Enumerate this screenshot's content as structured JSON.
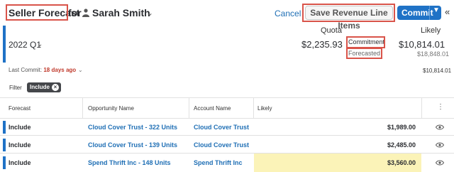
{
  "header": {
    "title": "Seller Forecast",
    "for_word": "for",
    "user_name": "Sarah Smith",
    "cancel_label": "Cancel",
    "save_label": "Save Revenue Line Items",
    "commit_label": "Commit",
    "icons": [
      "user-icon",
      "chevron-down-icon",
      "caret-down-icon",
      "collapse-icon"
    ]
  },
  "summary": {
    "period": "2022 Q1",
    "quota_label": "Quota",
    "likely_label": "Likely",
    "quota_value": "$2,235.93",
    "commitment_label": "Commitment",
    "commitment_value": "$10,814.01",
    "forecasted_label": "Forecasted",
    "forecasted_value": "$18,848.01",
    "last_commit_label": "Last Commit:",
    "last_commit_ago": "18 days ago",
    "last_commit_value": "$10,814.01"
  },
  "filter": {
    "label": "Filter",
    "pill": "Include"
  },
  "table": {
    "columns": [
      "Forecast",
      "Opportunity Name",
      "Account Name",
      "Likely"
    ],
    "rows": [
      {
        "forecast": "Include",
        "opportunity": "Cloud Cover Trust - 322 Units",
        "account": "Cloud Cover Trust",
        "likely": "$1,989.00",
        "highlighted": false
      },
      {
        "forecast": "Include",
        "opportunity": "Cloud Cover Trust - 139 Units",
        "account": "Cloud Cover Trust",
        "likely": "$2,485.00",
        "highlighted": false
      },
      {
        "forecast": "Include",
        "opportunity": "Spend Thrift Inc - 148 Units",
        "account": "Spend Thrift Inc",
        "likely": "$3,560.00",
        "highlighted": true
      }
    ]
  },
  "colors": {
    "accent": "#1f72c6",
    "link": "#1f6fb5",
    "annotation": "#d9544a",
    "highlight": "#fbf3b8",
    "warning_text": "#c0392b"
  }
}
